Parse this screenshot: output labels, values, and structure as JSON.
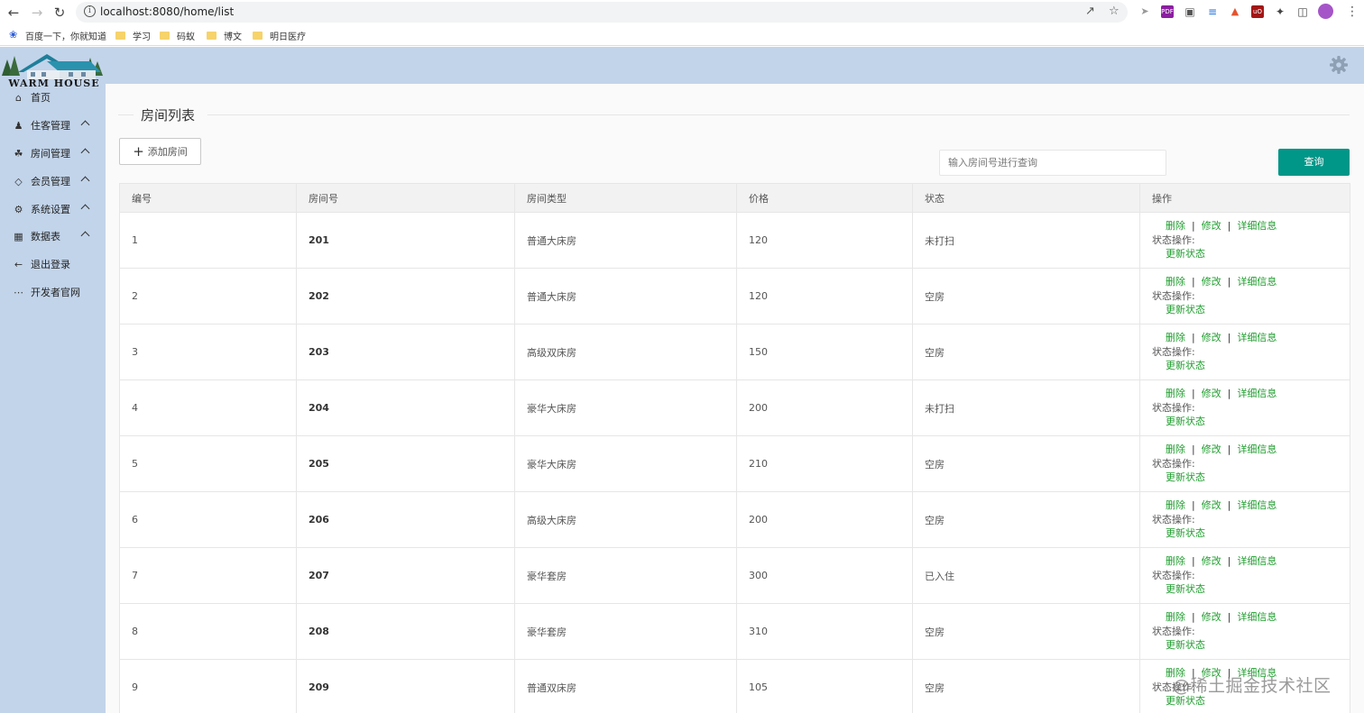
{
  "browser": {
    "url": "localhost:8080/home/list",
    "bookmarks": [
      "百度一下，你就知道",
      "学习",
      "码蚁",
      "博文",
      "明日医疗"
    ]
  },
  "logo": {
    "text": "WARM HOUSE"
  },
  "sidebar": {
    "items": [
      {
        "label": "首页",
        "icon": "home-icon",
        "expandable": false
      },
      {
        "label": "住客管理",
        "icon": "user-icon",
        "expandable": true
      },
      {
        "label": "房间管理",
        "icon": "palm-icon",
        "expandable": true
      },
      {
        "label": "会员管理",
        "icon": "diamond-icon",
        "expandable": true
      },
      {
        "label": "系统设置",
        "icon": "settings-icon",
        "expandable": true
      },
      {
        "label": "数据表",
        "icon": "table-icon",
        "expandable": true
      },
      {
        "label": "退出登录",
        "icon": "arrow-left-icon",
        "expandable": false
      },
      {
        "label": "开发者官网",
        "icon": "more-icon",
        "expandable": false
      }
    ]
  },
  "main": {
    "title": "房间列表",
    "add_button": "添加房间",
    "search": {
      "placeholder": "输入房间号进行查询",
      "value": ""
    },
    "query_button": "查询",
    "table": {
      "headers": [
        "编号",
        "房间号",
        "房间类型",
        "价格",
        "状态",
        "操作"
      ],
      "rows": [
        {
          "id": "1",
          "room": "201",
          "type": "普通大床房",
          "price": "120",
          "status": "未打扫",
          "status_kind": "dirty"
        },
        {
          "id": "2",
          "room": "202",
          "type": "普通大床房",
          "price": "120",
          "status": "空房",
          "status_kind": "empty"
        },
        {
          "id": "3",
          "room": "203",
          "type": "高级双床房",
          "price": "150",
          "status": "空房",
          "status_kind": "empty"
        },
        {
          "id": "4",
          "room": "204",
          "type": "豪华大床房",
          "price": "200",
          "status": "未打扫",
          "status_kind": "dirty"
        },
        {
          "id": "5",
          "room": "205",
          "type": "豪华大床房",
          "price": "210",
          "status": "空房",
          "status_kind": "empty"
        },
        {
          "id": "6",
          "room": "206",
          "type": "高级大床房",
          "price": "200",
          "status": "空房",
          "status_kind": "empty"
        },
        {
          "id": "7",
          "room": "207",
          "type": "豪华套房",
          "price": "300",
          "status": "已入住",
          "status_kind": "occupied"
        },
        {
          "id": "8",
          "room": "208",
          "type": "豪华套房",
          "price": "310",
          "status": "空房",
          "status_kind": "empty"
        },
        {
          "id": "9",
          "room": "209",
          "type": "普通双床房",
          "price": "105",
          "status": "空房",
          "status_kind": "empty"
        }
      ],
      "actions": {
        "delete": "删除",
        "edit": "修改",
        "details": "详细信息",
        "separator": "|",
        "status_ops_label": "状态操作:",
        "update_status": "更新状态"
      }
    }
  },
  "watermark": "@稀土掘金技术社区",
  "colors": {
    "sidebar_bg": "#c2d4ea",
    "primary_button": "#009688",
    "action_link": "#1f9d2e",
    "status_dirty": "#b5a36b",
    "status_empty": "#4e79c9",
    "status_occupied": "#d0312d"
  }
}
